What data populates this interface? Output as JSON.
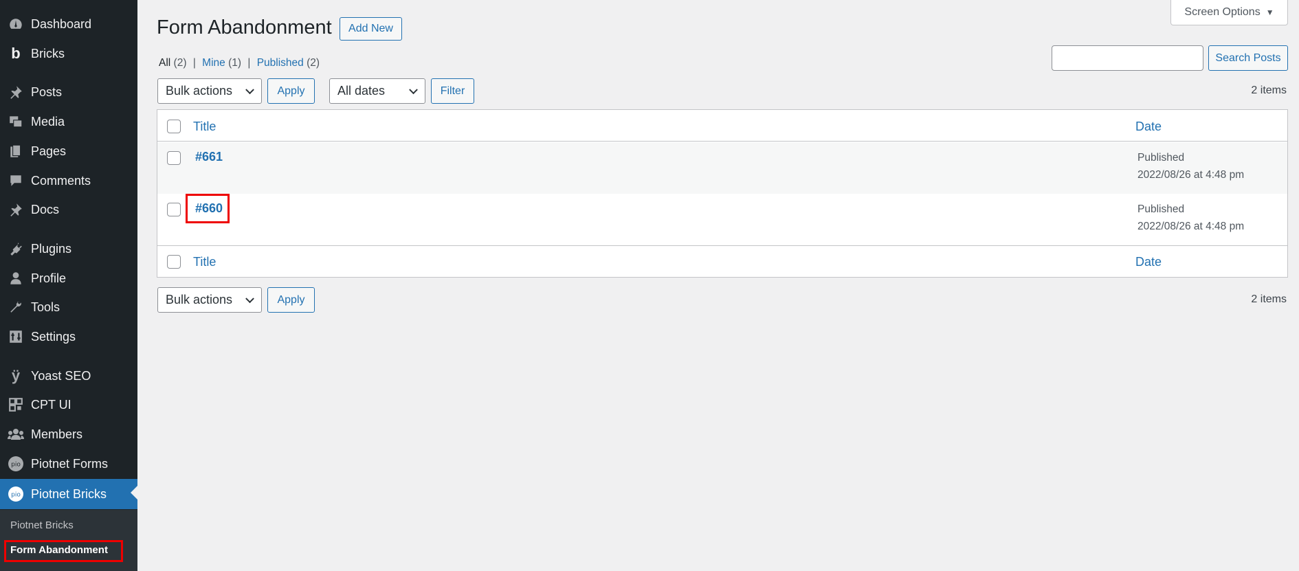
{
  "sidebar": {
    "items": [
      {
        "label": "Dashboard",
        "icon": "dashboard-icon"
      },
      {
        "label": "Bricks",
        "icon": "bricks-icon"
      },
      {
        "label": "Posts",
        "icon": "pin-icon"
      },
      {
        "label": "Media",
        "icon": "media-icon"
      },
      {
        "label": "Pages",
        "icon": "pages-icon"
      },
      {
        "label": "Comments",
        "icon": "comment-icon"
      },
      {
        "label": "Docs",
        "icon": "pin-icon"
      },
      {
        "label": "Plugins",
        "icon": "plugin-icon"
      },
      {
        "label": "Profile",
        "icon": "user-icon"
      },
      {
        "label": "Tools",
        "icon": "wrench-icon"
      },
      {
        "label": "Settings",
        "icon": "settings-icon"
      },
      {
        "label": "Yoast SEO",
        "icon": "yoast-icon"
      },
      {
        "label": "CPT UI",
        "icon": "cpt-icon"
      },
      {
        "label": "Members",
        "icon": "members-icon"
      },
      {
        "label": "Piotnet Forms",
        "icon": "piotnet-icon"
      },
      {
        "label": "Piotnet Bricks",
        "icon": "piotnet-icon"
      }
    ],
    "submenu": [
      {
        "label": "Piotnet Bricks"
      },
      {
        "label": "Form Abandonment"
      }
    ]
  },
  "header": {
    "screen_options": "Screen Options",
    "title": "Form Abandonment",
    "add_new": "Add New"
  },
  "views": {
    "all": "All",
    "all_count": "(2)",
    "mine": "Mine",
    "mine_count": "(1)",
    "published": "Published",
    "published_count": "(2)",
    "sep": "|"
  },
  "search": {
    "button": "Search Posts",
    "value": ""
  },
  "top_nav": {
    "bulk_actions": "Bulk actions",
    "apply": "Apply",
    "dates": "All dates",
    "filter": "Filter",
    "items": "2 items"
  },
  "table": {
    "col_title": "Title",
    "col_date": "Date",
    "rows": [
      {
        "title": "#661",
        "status": "Published",
        "date": "2022/08/26 at 4:48 pm"
      },
      {
        "title": "#660",
        "status": "Published",
        "date": "2022/08/26 at 4:48 pm"
      }
    ]
  },
  "bottom_nav": {
    "bulk_actions": "Bulk actions",
    "apply": "Apply",
    "items": "2 items"
  },
  "colors": {
    "accent": "#2271b1",
    "sidebar": "#1d2327",
    "highlight": "#e00000"
  }
}
